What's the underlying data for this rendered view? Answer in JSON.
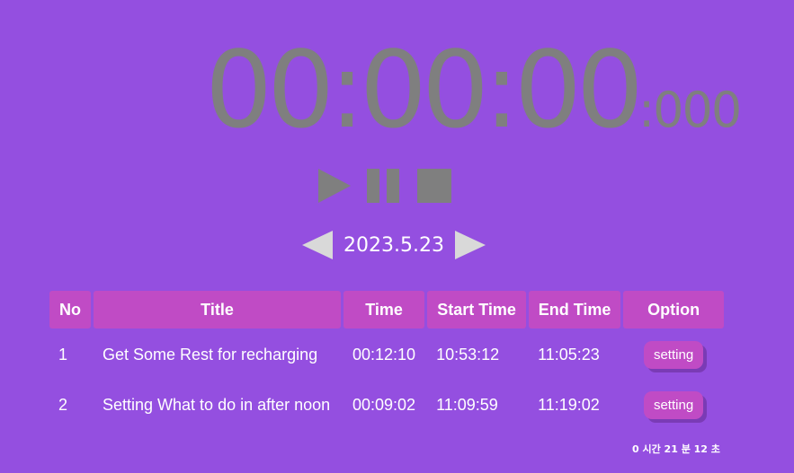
{
  "timer": {
    "main": "00:00:00",
    "ms": ":000"
  },
  "controls": {
    "play": "play-icon",
    "pause": "pause-icon",
    "stop": "stop-icon"
  },
  "date_nav": {
    "date": "2023.5.23"
  },
  "table": {
    "headers": [
      "No",
      "Title",
      "Time",
      "Start Time",
      "End Time",
      "Option"
    ],
    "rows": [
      {
        "no": "1",
        "title": "Get Some Rest for recharging",
        "time": "00:12:10",
        "start": "10:53:12",
        "end": "11:05:23",
        "option": "setting"
      },
      {
        "no": "2",
        "title": "Setting What to do in after noon",
        "time": "00:09:02",
        "start": "11:09:59",
        "end": "11:19:02",
        "option": "setting"
      }
    ]
  },
  "total": "0 시간 21 분 12 초",
  "colors": {
    "background": "#944fe0",
    "accent": "#c04bc5",
    "timer_text": "#7f7f7f"
  }
}
